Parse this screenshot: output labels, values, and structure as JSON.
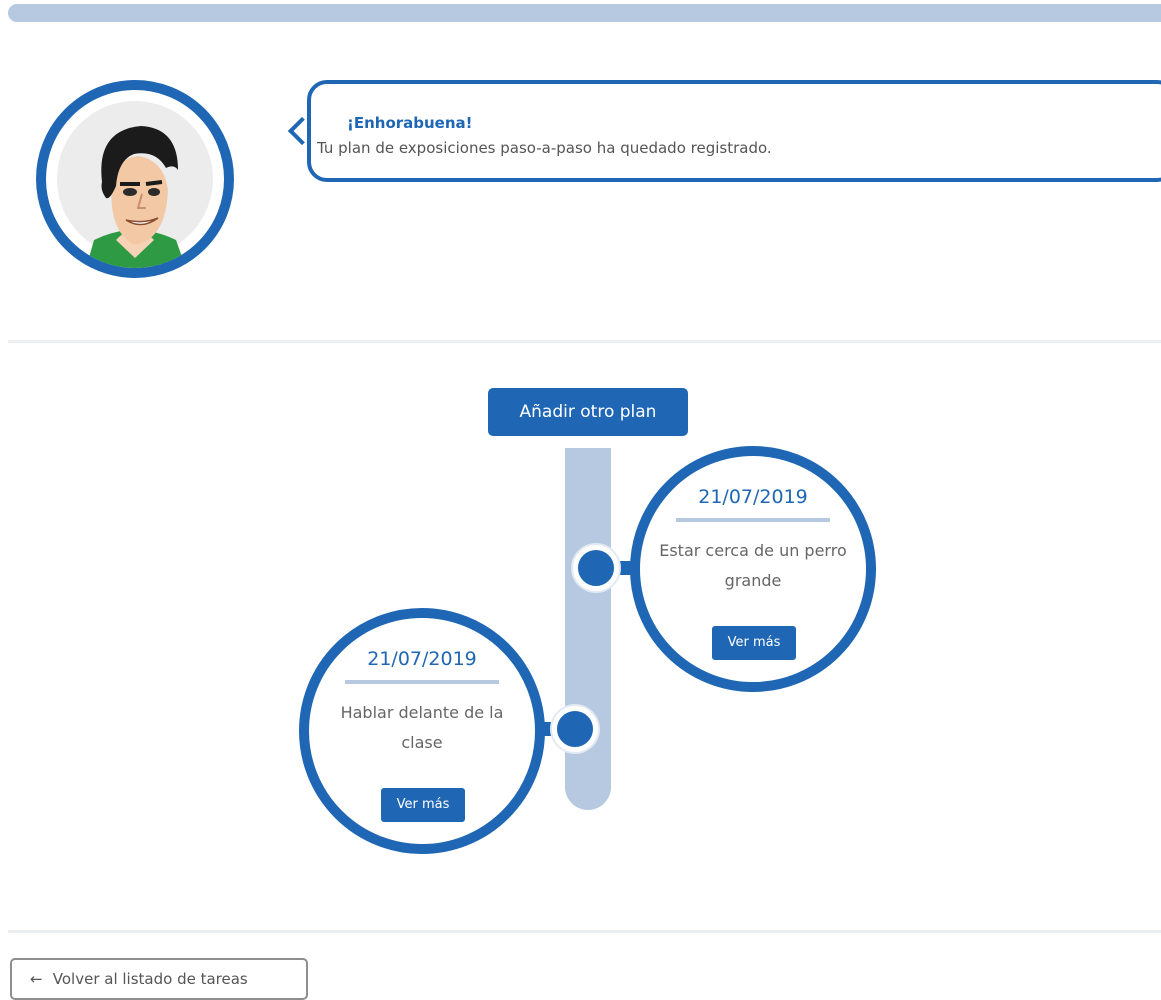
{
  "message": {
    "title": "¡Enhorabuena!",
    "text": "Tu plan de exposiciones paso-a-paso ha quedado registrado."
  },
  "actions": {
    "add_plan": "Añadir otro plan",
    "back": "Volver al listado de tareas",
    "back_icon": "arrow-left-icon"
  },
  "plans": [
    {
      "date": "21/07/2019",
      "description": "Estar cerca de un perro grande",
      "more_label": "Ver más"
    },
    {
      "date": "21/07/2019",
      "description": "Hablar delante de la clase",
      "more_label": "Ver más"
    }
  ],
  "colors": {
    "primary": "#1f67b4",
    "track": "#b7c9e1",
    "divider": "#eceff2"
  }
}
